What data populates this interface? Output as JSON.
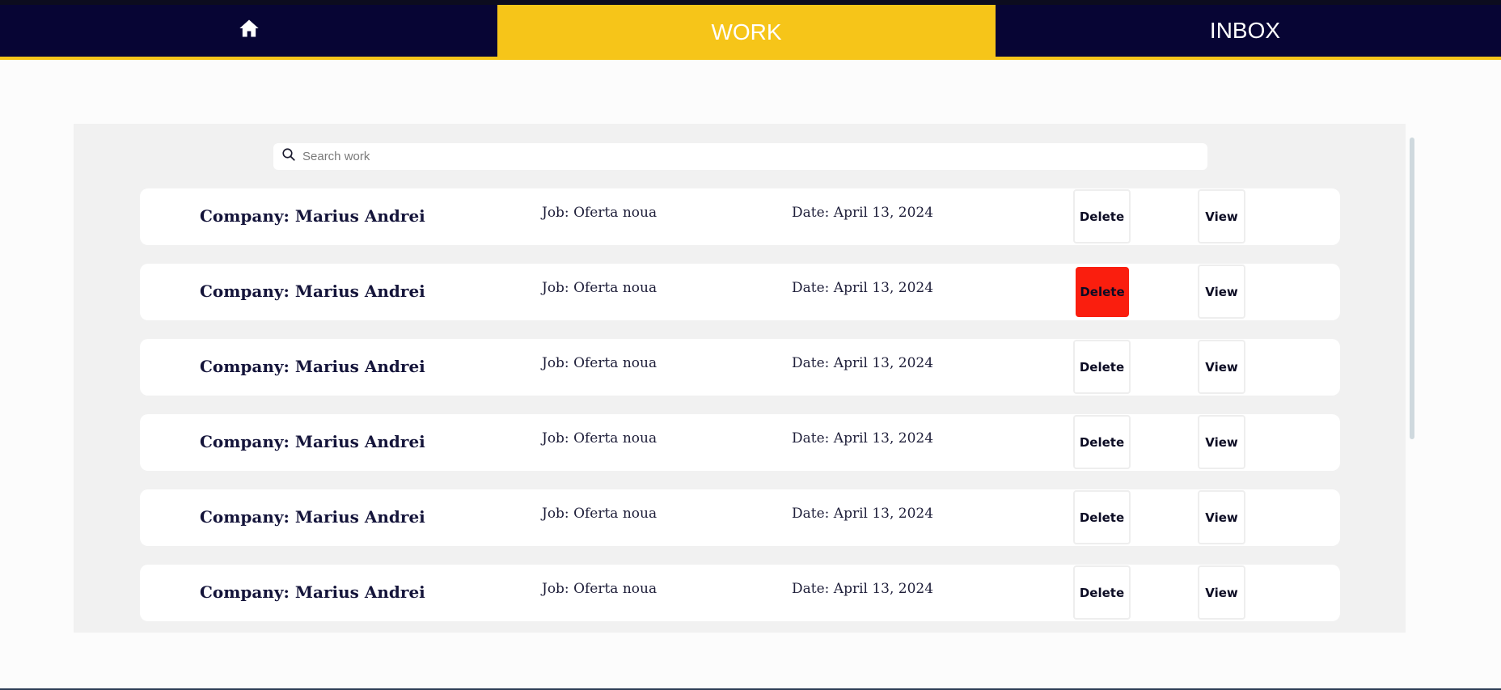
{
  "nav": {
    "tabs": [
      {
        "label": "",
        "icon": "home-icon"
      },
      {
        "label": "WORK",
        "active": true
      },
      {
        "label": "INBOX"
      }
    ]
  },
  "colors": {
    "navbar": "#070534",
    "accent": "#f6c519",
    "delete_hover": "#fa1e0e"
  },
  "search": {
    "placeholder": "Search work",
    "value": ""
  },
  "work_items": [
    {
      "company": "Company: Marius Andrei",
      "job": "Job: Oferta noua",
      "date": "Date: April 13, 2024",
      "delete_label": "Delete",
      "view_label": "View"
    },
    {
      "company": "Company: Marius Andrei",
      "job": "Job: Oferta noua",
      "date": "Date: April 13, 2024",
      "delete_label": "Delete",
      "view_label": "View",
      "delete_hovered": true
    },
    {
      "company": "Company: Marius Andrei",
      "job": "Job: Oferta noua",
      "date": "Date: April 13, 2024",
      "delete_label": "Delete",
      "view_label": "View"
    },
    {
      "company": "Company: Marius Andrei",
      "job": "Job: Oferta noua",
      "date": "Date: April 13, 2024",
      "delete_label": "Delete",
      "view_label": "View"
    },
    {
      "company": "Company: Marius Andrei",
      "job": "Job: Oferta noua",
      "date": "Date: April 13, 2024",
      "delete_label": "Delete",
      "view_label": "View"
    },
    {
      "company": "Company: Marius Andrei",
      "job": "Job: Oferta noua",
      "date": "Date: April 13, 2024",
      "delete_label": "Delete",
      "view_label": "View"
    }
  ]
}
